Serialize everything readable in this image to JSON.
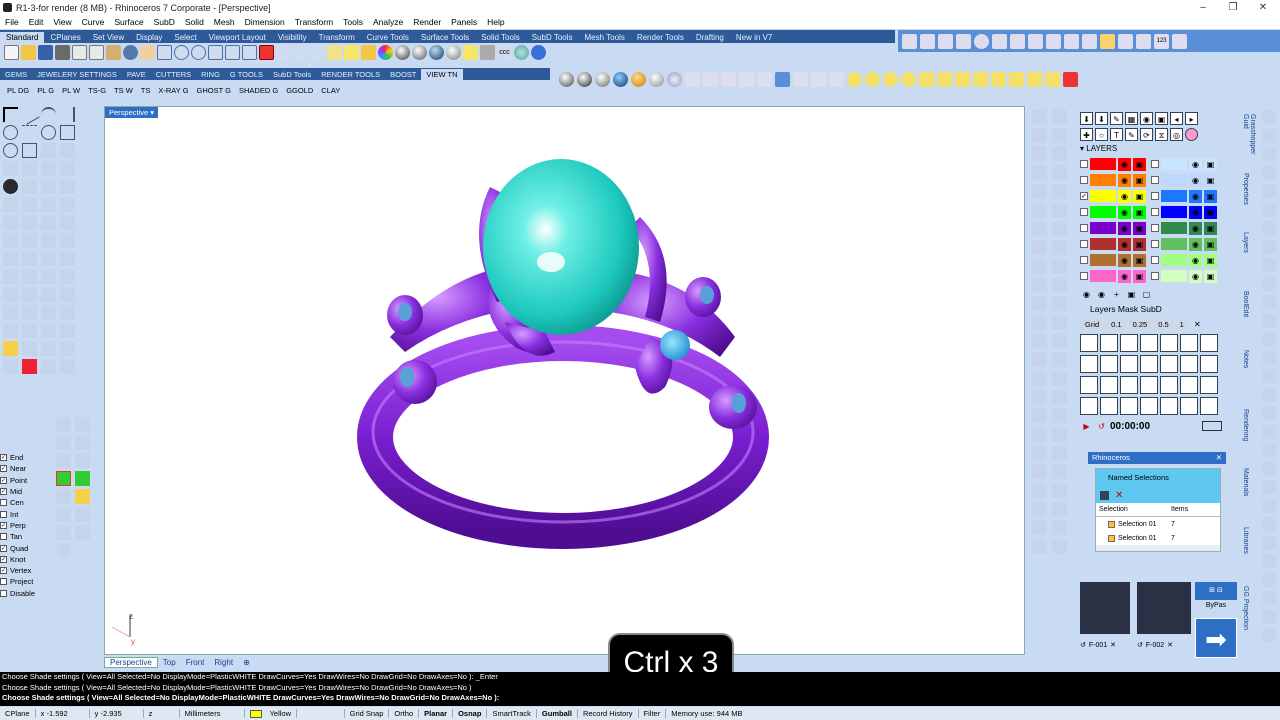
{
  "window": {
    "title": "R1-3-for render (8 MB) - Rhinoceros 7 Corporate - [Perspective]",
    "controls": [
      "–",
      "❐",
      "✕"
    ]
  },
  "menu": [
    "File",
    "Edit",
    "View",
    "Curve",
    "Surface",
    "SubD",
    "Solid",
    "Mesh",
    "Dimension",
    "Transform",
    "Tools",
    "Analyze",
    "Render",
    "Panels",
    "Help"
  ],
  "tabs_main": [
    "Standard",
    "CPlanes",
    "Set View",
    "Display",
    "Select",
    "Viewport Layout",
    "Visibility",
    "Transform",
    "Curve Tools",
    "Surface Tools",
    "Solid Tools",
    "SubD Tools",
    "Mesh Tools",
    "Render Tools",
    "Drafting",
    "New in V7"
  ],
  "tabs_plugin": [
    "GEMS",
    "JEWELERY SETTINGS",
    "PAVE",
    "CUTTERS",
    "RING",
    "G TOOLS",
    "SubD Tools",
    "RENDER TOOLS",
    "BOOST",
    "VIEW TN"
  ],
  "display_buttons": [
    "PL DG",
    "PL G",
    "PL W",
    "TS-G",
    "TS W",
    "TS",
    "X-RAY G",
    "GHOST G",
    "SHADED G",
    "GGOLD",
    "CLAY"
  ],
  "osnaps": [
    {
      "label": "End",
      "checked": true
    },
    {
      "label": "Near",
      "checked": true
    },
    {
      "label": "Point",
      "checked": true
    },
    {
      "label": "Mid",
      "checked": true
    },
    {
      "label": "Cen",
      "checked": false
    },
    {
      "label": "Int",
      "checked": false
    },
    {
      "label": "Perp",
      "checked": true
    },
    {
      "label": "Tan",
      "checked": false
    },
    {
      "label": "Quad",
      "checked": true
    },
    {
      "label": "Knot",
      "checked": true
    },
    {
      "label": "Vertex",
      "checked": true
    },
    {
      "label": "Project",
      "checked": false
    },
    {
      "label": "Disable",
      "checked": false
    }
  ],
  "viewport": {
    "name": "Perspective",
    "axis_z": "z",
    "axis_y": "y"
  },
  "viewport_tabs": [
    "Perspective",
    "Top",
    "Front",
    "Right"
  ],
  "overlay": "Ctrl x 3",
  "panel": {
    "layers_title": "LAYERS",
    "layer_colors_left": [
      "#ff0000",
      "#ff8000",
      "#ffff00",
      "#00ff00",
      "#7a00cc",
      "#b03030",
      "#b07030",
      "#ff66cc"
    ],
    "layer_colors_right": [
      "#c8e4ff",
      "#c0d8ff",
      "#1e78ff",
      "#0000ff",
      "#2e8a4e",
      "#60c060",
      "#a0ff80",
      "#d0ffc0"
    ],
    "mask_title": "Layers Mask SubD",
    "grid_row": [
      "Grid",
      "0.1",
      "0.25",
      "0.5",
      "1"
    ],
    "timer": "00:00:00",
    "rhino_title": "Rhinoceros",
    "named_title": "Named Selections",
    "named_cols": [
      "Selection",
      "Items"
    ],
    "named_rows": [
      {
        "name": "Selection 01",
        "items": "7"
      },
      {
        "name": "Selection 01",
        "items": "7"
      }
    ],
    "bypass": "ByPas",
    "thumbs": [
      "F-001",
      "F-002"
    ]
  },
  "vertical_tabs": [
    "Grasshopper Guid",
    "Properties",
    "Layers",
    "BoolEdit",
    "Notes",
    "Rendering",
    "Materials",
    "Libraries",
    "GG Projection"
  ],
  "command_lines": [
    "Choose Shade settings ( View=All  Selected=No  DisplayMode=PlasticWHITE  DrawCurves=Yes  DrawWires=No  DrawGrid=No  DrawAxes=No ): _Enter",
    "Choose Shade settings ( View=All  Selected=No  DisplayMode=PlasticWHITE  DrawCurves=Yes  DrawWires=No  DrawGrid=No  DrawAxes=No )",
    "Choose Shade settings ( View=All  Selected=No  DisplayMode=PlasticWHITE  DrawCurves=Yes  DrawWires=No  DrawGrid=No  DrawAxes=No ):"
  ],
  "status": {
    "cplane": "CPlane",
    "x": "x -1.592",
    "y": "y -2.935",
    "z": "z",
    "units": "Millimeters",
    "layer": "Yellow",
    "toggles": [
      "Grid Snap",
      "Ortho",
      "Planar",
      "Osnap",
      "SmartTrack",
      "Gumball",
      "Record History",
      "Filter"
    ],
    "memory": "Memory use: 944 MB"
  },
  "colors": {
    "accent": "#2e6ec5",
    "ring": "#7a1fd0",
    "gem": "#1fd4c8",
    "prong_gem": "#2aa8e0"
  }
}
